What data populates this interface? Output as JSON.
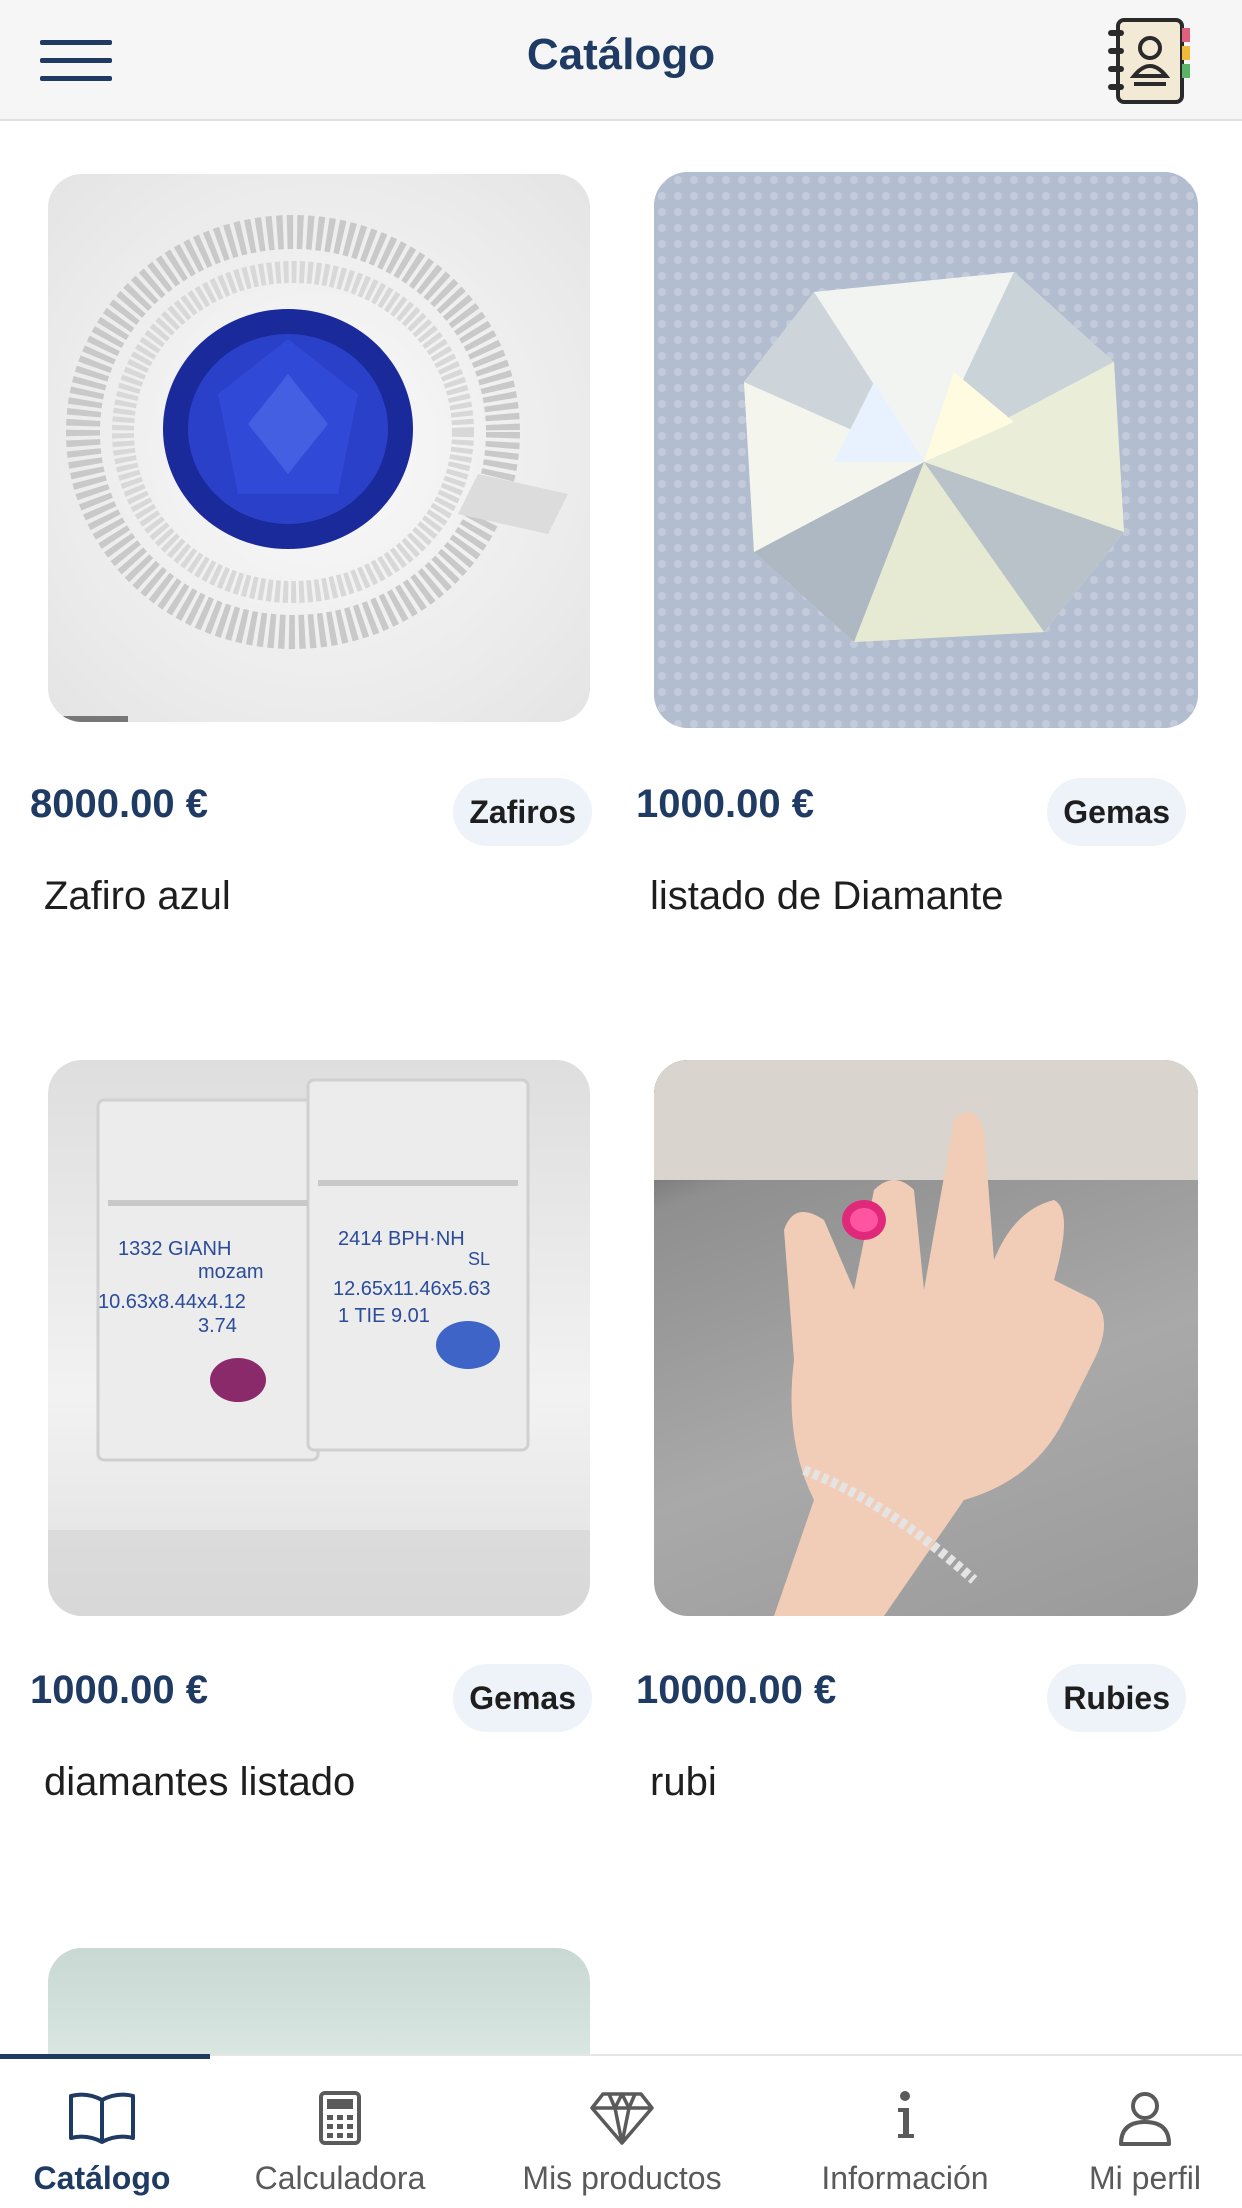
{
  "header": {
    "title": "Catálogo"
  },
  "products": [
    {
      "price": "8000.00 €",
      "category": "Zafiros",
      "name": "Zafiro azul"
    },
    {
      "price": "1000.00 €",
      "category": "Gemas",
      "name": "listado de Diamante"
    },
    {
      "price": "1000.00 €",
      "category": "Gemas",
      "name": "diamantes listado"
    },
    {
      "price": "10000.00 €",
      "category": "Rubies",
      "name": "rubi"
    }
  ],
  "nav": [
    {
      "label": "Catálogo",
      "icon": "book-open-icon",
      "active": true
    },
    {
      "label": "Calculadora",
      "icon": "calculator-icon",
      "active": false
    },
    {
      "label": "Mis productos",
      "icon": "diamond-icon",
      "active": false
    },
    {
      "label": "Información",
      "icon": "info-icon",
      "active": false
    },
    {
      "label": "Mi perfil",
      "icon": "user-icon",
      "active": false
    }
  ],
  "colors": {
    "primary": "#1f3b63",
    "badge_bg": "#eef3f9",
    "header_bg": "#f6f6f6"
  }
}
